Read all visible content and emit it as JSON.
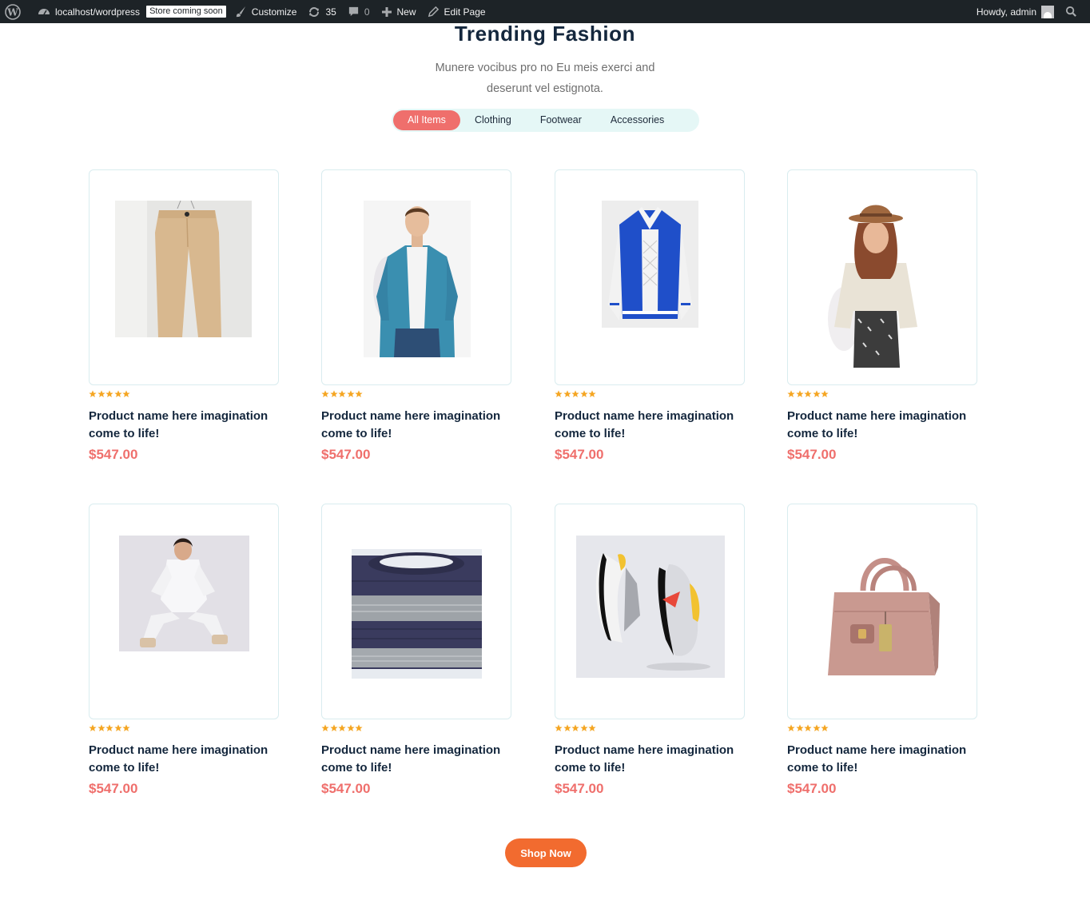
{
  "adminbar": {
    "site": "localhost/wordpress",
    "badge": "Store coming soon",
    "customize": "Customize",
    "updates": "35",
    "comments": "0",
    "new": "New",
    "edit": "Edit Page",
    "howdy": "Howdy, admin"
  },
  "section": {
    "title": "Trending Fashion",
    "subtitle": "Munere vocibus pro no Eu meis exerci and deserunt vel estignota."
  },
  "tabs": [
    "All Items",
    "Clothing",
    "Footwear",
    "Accessories"
  ],
  "products": [
    {
      "image": "beige-trousers",
      "rating": 5,
      "name": "Product name here imagination come to life!",
      "price": "$547.00"
    },
    {
      "image": "denim-shirt-man",
      "rating": 5,
      "name": "Product name here imagination come to life!",
      "price": "$547.00"
    },
    {
      "image": "blue-varsity-jacket",
      "rating": 5,
      "name": "Product name here imagination come to life!",
      "price": "$547.00"
    },
    {
      "image": "woman-with-hat",
      "rating": 5,
      "name": "Product name here imagination come to life!",
      "price": "$547.00"
    },
    {
      "image": "white-tracksuit-woman",
      "rating": 5,
      "name": "Product name here imagination come to life!",
      "price": "$547.00"
    },
    {
      "image": "striped-sweater",
      "rating": 5,
      "name": "Product name here imagination come to life!",
      "price": "$547.00"
    },
    {
      "image": "sneakers",
      "rating": 5,
      "name": "Product name here imagination come to life!",
      "price": "$547.00"
    },
    {
      "image": "pink-handbag",
      "rating": 5,
      "name": "Product name here imagination come to life!",
      "price": "$547.00"
    }
  ],
  "cta": {
    "label": "Shop Now"
  },
  "colors": {
    "accent": "#ef6f6c",
    "button": "#f26b2f",
    "star": "#f5a623",
    "tabs_bg": "#e5f7f6"
  }
}
